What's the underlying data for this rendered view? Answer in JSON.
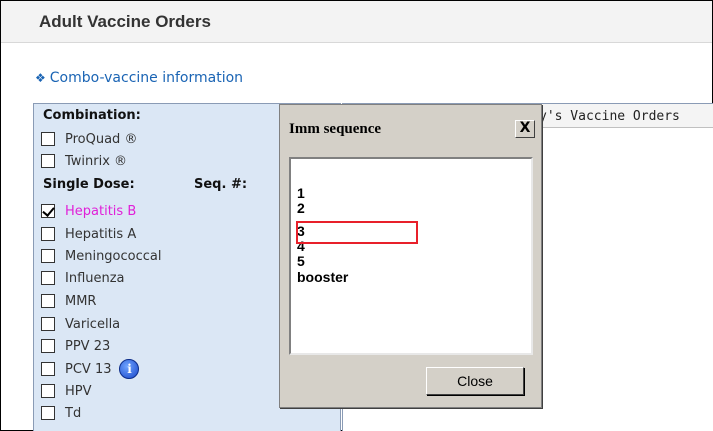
{
  "header": {
    "title": "Adult Vaccine Orders"
  },
  "combo_link": {
    "icon": "diamond-icon",
    "label": "Combo-vaccine information"
  },
  "left_panel": {
    "combination_label": "Combination:",
    "combinations": [
      {
        "label": "ProQuad ®",
        "checked": false
      },
      {
        "label": "Twinrix ®",
        "checked": false
      }
    ],
    "single_dose_label": "Single Dose:",
    "seq_label": "Seq. #:",
    "single_doses": [
      {
        "label": "Hepatitis B",
        "checked": true,
        "highlight": true
      },
      {
        "label": "Hepatitis A",
        "checked": false
      },
      {
        "label": "Meningococcal",
        "checked": false
      },
      {
        "label": "Influenza",
        "checked": false
      },
      {
        "label": "MMR",
        "checked": false
      },
      {
        "label": "Varicella",
        "checked": false
      },
      {
        "label": "PPV 23",
        "checked": false
      },
      {
        "label": "PCV 13",
        "checked": false,
        "info_icon": true
      },
      {
        "label": "HPV",
        "checked": false
      },
      {
        "label": "Td",
        "checked": false
      }
    ]
  },
  "right_pane": {
    "header_text": "y's Vaccine Orders"
  },
  "dialog": {
    "title": "Imm sequence",
    "close_glyph": "X",
    "items": [
      "1",
      "2",
      "3",
      "4",
      "5",
      "booster"
    ],
    "highlighted_item": "3",
    "close_label": "Close"
  },
  "colors": {
    "highlight": "#e020d8",
    "link": "#1a64b4",
    "panel": "#dbe7f5",
    "selection_border": "#e8202a"
  }
}
